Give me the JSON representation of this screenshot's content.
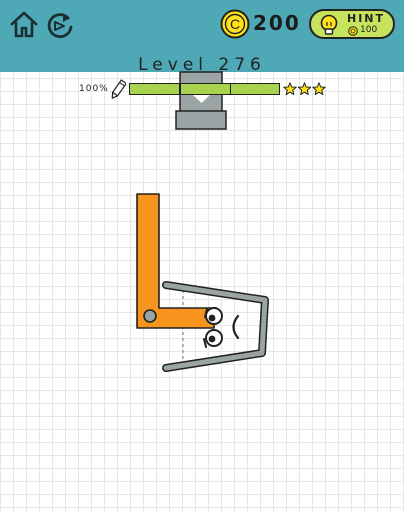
{
  "toolbar": {
    "home_icon": "home-icon",
    "restart_icon": "restart-icon"
  },
  "coins": {
    "icon": "coin-icon",
    "symbol": "C",
    "count": "200"
  },
  "hint": {
    "label": "HINT",
    "cost": "100",
    "icon": "lightbulb-icon"
  },
  "level": {
    "title": "Level 276"
  },
  "ink": {
    "percent_label": "100%",
    "fill_fraction": 1.0,
    "star_thresholds": [
      0.33,
      0.67
    ],
    "stars_earned": 3,
    "stars_total": 3
  },
  "colors": {
    "topbar": "#4fa8b6",
    "accent_green": "#a8d34f",
    "coin_yellow": "#ffe11a",
    "orange_piece": "#f7941d",
    "glass_gray": "#9aa4a4",
    "star_yellow": "#ffe11a"
  },
  "scene": {
    "dispenser": "water-dispenser",
    "lever": "orange-l-lever",
    "glass": "sad-glass-character",
    "face": "sad-face"
  }
}
